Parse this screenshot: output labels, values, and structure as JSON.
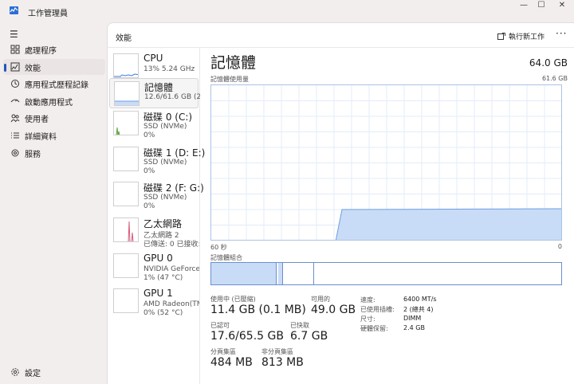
{
  "window": {
    "title": "工作管理員",
    "minimize_glyph": "—",
    "maximize_glyph": "☐",
    "close_glyph": "✕"
  },
  "sidebar": {
    "items": [
      {
        "label": "處理程序",
        "icon": "processes-icon"
      },
      {
        "label": "效能",
        "icon": "performance-icon"
      },
      {
        "label": "應用程式歷程記錄",
        "icon": "app-history-icon"
      },
      {
        "label": "啟動應用程式",
        "icon": "startup-apps-icon"
      },
      {
        "label": "使用者",
        "icon": "users-icon"
      },
      {
        "label": "詳細資料",
        "icon": "details-icon"
      },
      {
        "label": "服務",
        "icon": "services-icon"
      }
    ],
    "settings_label": "設定",
    "active_index": 1
  },
  "header": {
    "title": "效能",
    "run_task_label": "執行新工作",
    "more_glyph": "···"
  },
  "devices": [
    {
      "name": "CPU",
      "sub1": "13%  5.24 GHz",
      "sub2": ""
    },
    {
      "name": "記憶體",
      "sub1": "12.6/61.6 GB (20%)",
      "sub2": ""
    },
    {
      "name": "磁碟 0 (C:)",
      "sub1": "SSD (NVMe)",
      "sub2": "0%"
    },
    {
      "name": "磁碟 1 (D: E:)",
      "sub1": "SSD (NVMe)",
      "sub2": "0%"
    },
    {
      "name": "磁碟 2 (F: G:)",
      "sub1": "SSD (NVMe)",
      "sub2": "0%"
    },
    {
      "name": "乙太網路",
      "sub1": "乙太網路 2",
      "sub2": "已傳送: 0 已接收: 0 Kbps"
    },
    {
      "name": "GPU 0",
      "sub1": "NVIDIA GeForce RTX",
      "sub2": "1% (47 °C)"
    },
    {
      "name": "GPU 1",
      "sub1": "AMD Radeon(TM) Graphics",
      "sub2": "0% (52 °C)"
    }
  ],
  "memory": {
    "title": "記憶體",
    "total": "64.0 GB",
    "usage_label": "記憶體使用量",
    "usage_max": "61.6 GB",
    "axis_left": "60 秒",
    "axis_right": "0",
    "composition_label": "記憶體組合",
    "in_use_fraction": 0.19,
    "stats": {
      "in_use_label": "使用中 (已壓縮)",
      "in_use_value": "11.4 GB (0.1 MB)",
      "available_label": "可用的",
      "available_value": "49.0 GB",
      "committed_label": "已認可",
      "committed_value": "17.6/65.5 GB",
      "cached_label": "已快取",
      "cached_value": "6.7 GB",
      "paged_label": "分頁集區",
      "paged_value": "484 MB",
      "nonpaged_label": "非分頁集區",
      "nonpaged_value": "813 MB"
    },
    "details": [
      {
        "key": "速度:",
        "value": "6400 MT/s"
      },
      {
        "key": "已使用插槽:",
        "value": "2 (總共 4)"
      },
      {
        "key": "尺寸:",
        "value": "DIMM"
      },
      {
        "key": "硬體保留:",
        "value": "2.4 GB"
      }
    ]
  },
  "colors": {
    "accent": "#1f58b8",
    "memory_fill": "#c9dcf7",
    "memory_line": "#6b9ee0",
    "network_line": "#d75a7a"
  }
}
